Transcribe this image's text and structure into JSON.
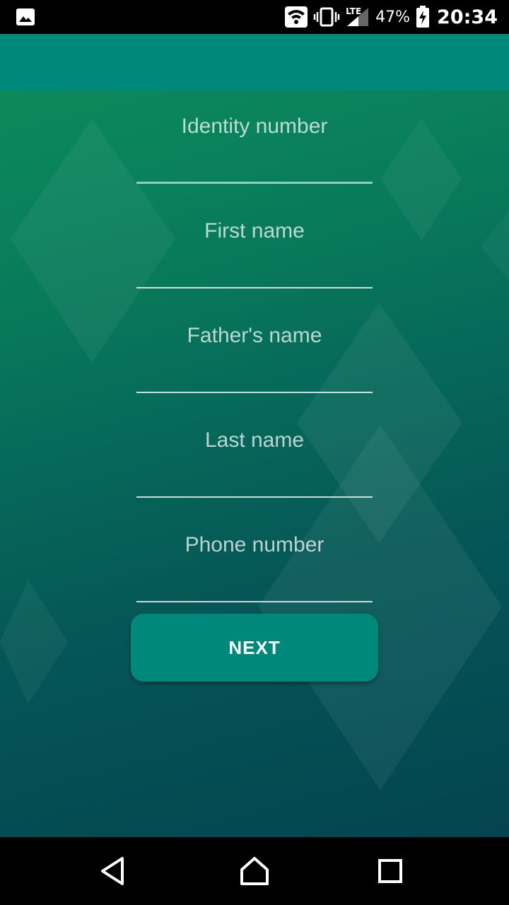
{
  "status_bar": {
    "battery_percent": "47%",
    "time": "20:34",
    "network_type": "LTE",
    "icons": [
      "image-icon",
      "wifi-icon",
      "vibrate-icon",
      "signal-icon",
      "battery-charging-icon"
    ]
  },
  "form": {
    "fields": [
      {
        "label": "Identity number",
        "focused": true
      },
      {
        "label": "First name",
        "focused": false
      },
      {
        "label": "Father's name",
        "focused": false
      },
      {
        "label": "Last name",
        "focused": false
      },
      {
        "label": "Phone number",
        "focused": false
      }
    ],
    "next_label": "NEXT"
  },
  "colors": {
    "app_bar": "#00897b",
    "button": "#00897b",
    "focused_underline": "#8fd1c0"
  },
  "nav_bar": {
    "icons": [
      "back-icon",
      "home-icon",
      "recents-icon"
    ]
  }
}
